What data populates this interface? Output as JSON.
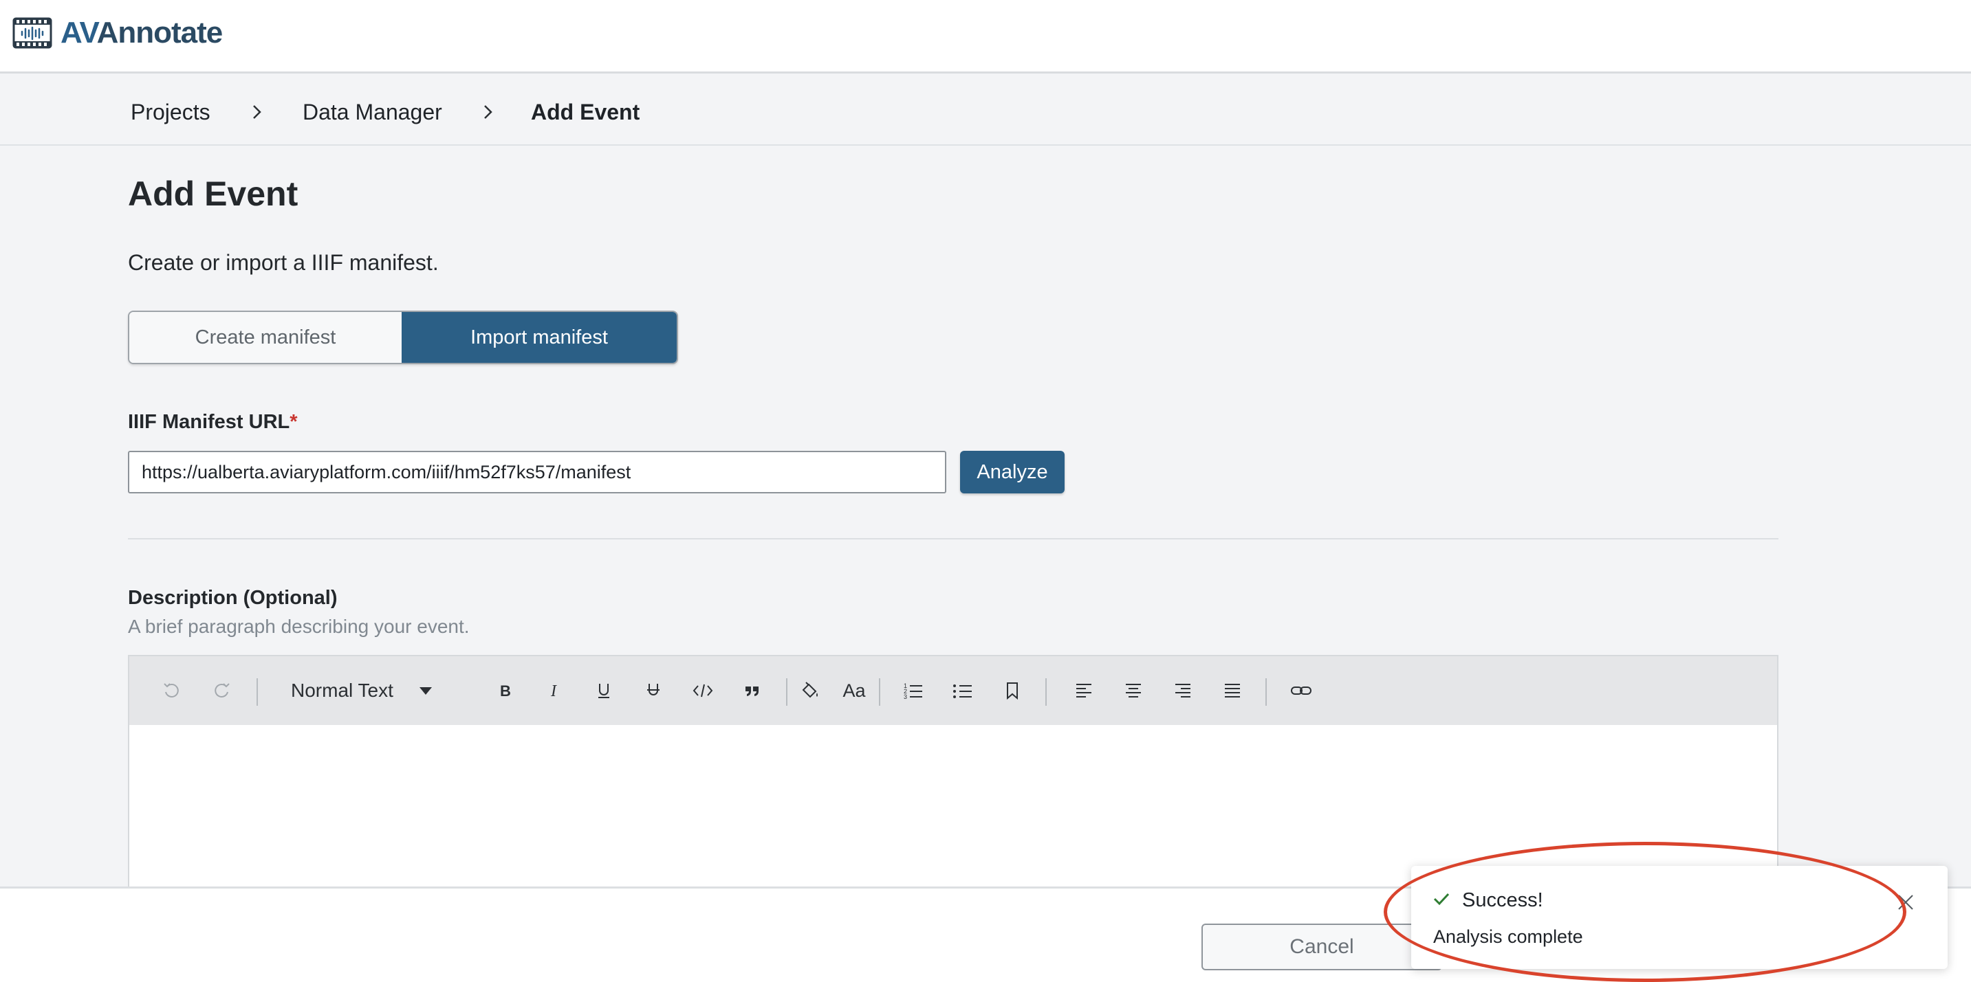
{
  "app": {
    "logo_text_prefix": "AV",
    "logo_text_rest": "Annotate",
    "logo_icon": "film-soundwave-icon"
  },
  "breadcrumb": {
    "items": [
      "Projects",
      "Data Manager",
      "Add Event"
    ],
    "separator_icon": "chevron-right-icon"
  },
  "page": {
    "title": "Add Event",
    "subtitle": "Create or import a IIIF manifest."
  },
  "manifest_toggle": {
    "options": [
      "Create manifest",
      "Import manifest"
    ],
    "selected": "Import manifest"
  },
  "manifest_url": {
    "label": "IIIF Manifest URL",
    "required_marker": "*",
    "value": "https://ualberta.aviaryplatform.com/iiif/hm52f7ks57/manifest",
    "analyze_label": "Analyze"
  },
  "description": {
    "label": "Description (Optional)",
    "help": "A brief paragraph describing your event.",
    "toolbar": {
      "block_type": "Normal Text",
      "buttons": [
        "undo-icon",
        "redo-icon",
        "bold-icon",
        "italic-icon",
        "underline-icon",
        "strikethrough-icon",
        "code-icon",
        "quote-icon",
        "highlight-color-icon",
        "font-case-icon",
        "ordered-list-icon",
        "bullet-list-icon",
        "bookmark-icon",
        "align-left-icon",
        "align-center-icon",
        "align-right-icon",
        "align-justify-icon",
        "link-icon"
      ],
      "font_case_glyph": "Aa"
    }
  },
  "footer": {
    "cancel_label": "Cancel"
  },
  "toast": {
    "title": "Success!",
    "message": "Analysis complete",
    "status_color": "#2e7d32"
  },
  "annotation": {
    "highlight_color": "#d9432c"
  }
}
